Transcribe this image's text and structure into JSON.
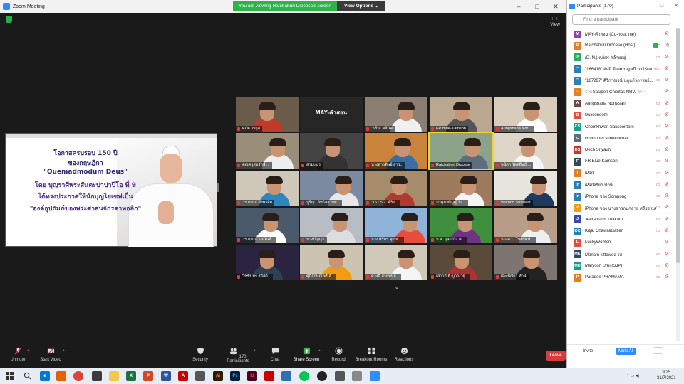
{
  "window": {
    "title": "Zoom Meeting",
    "banner": "You are viewing Ratchaburi Diocese's screen",
    "view_options": "View Options",
    "view_button": "View"
  },
  "slide": {
    "lines": [
      "โอกาสครบรอบ 150 ปี",
      "ของกฤษฎีกา",
      "\"Quemadmodum Deus\"",
      "โดย บุญราศีพระสันตะปาปาปีโอ ที่ 9",
      "ได้ทรงประกาศให้นักบุญโยเซฟเป็น",
      "\"องค์อุปถัมภ์ของพระศาสนจักรคาทอลิก\""
    ]
  },
  "tiles": [
    "ศุภัต วรกุล",
    "MAY-คำสอน",
    "\"ธรีน\" คลินิค",
    "FR.Blue-Kamson",
    "Aungshana Nor...",
    "คุณครูสุขรักษ์ ...",
    "สามเณร",
    "นางสาวทิพย์ สาร...",
    "Ratchaburi Diocese",
    "พนิดา รัตตสินธุ์ ...",
    "วราภรณ์ คึงพรจิต",
    "ปูรีญา อิทธิสงวนท...",
    "\"167297\" ศิริก...",
    "ภาศุภายัญญ์ มิ่ง...",
    "Waroon Srisawat",
    "วราภรณ์ ธนนันท์...",
    "นางปัญญา",
    "นาง ศิริพร คุณพ...",
    "น.ส. อุษาภัณ ค...",
    "นางสาว โชติรัตน์...",
    "วิชชินทร์ สวัสดิ์...",
    "ศุภิลักษณ์ พนิลั...",
    "ดวงดี สายพันธ์...",
    "เสาวณีย์ ญาณาตุ...",
    "iPadจริยา ทักษ์"
  ],
  "toolbar": {
    "unmute": "Unmute",
    "start_video": "Start Video",
    "security": "Security",
    "participants": "Participants",
    "participant_count": "170",
    "chat": "Chat",
    "share_screen": "Share Screen",
    "record": "Record",
    "breakout_rooms": "Breakout Rooms",
    "reactions": "Reactions",
    "leave": "Leave"
  },
  "panel": {
    "title": "Participants (170)",
    "search_placeholder": "Find a participant",
    "participants": [
      {
        "initial": "M",
        "name": "MAY-คำสอน (Co-host, me)",
        "color": "#8e44ad"
      },
      {
        "initial": "R",
        "name": "Ratchaburi Diocese (Host)",
        "color": "#e67e22"
      },
      {
        "initial": "(N",
        "name": "(D. N.) ศุภัศร คล้ายอยู่",
        "color": "#27ae60"
      },
      {
        "initial": "\"",
        "name": "\"166418\" อัจฉิ ต้นสมบุญหนี นาริรัฒนา...",
        "color": "#2980b9"
      },
      {
        "initial": "\"",
        "name": "\"167297\" ศิริกาญจน์ ปฏุแก้วกรรมย์...",
        "color": "#2980b9"
      },
      {
        "initial": "♡",
        "name": "♡☆Sasipen Chitutas NRV. ☆♡",
        "color": "#e67e22"
      },
      {
        "initial": "A",
        "name": "Aungshana Norrasan",
        "color": "#6d4c41"
      },
      {
        "initial": "B",
        "name": "Bosconoom",
        "color": "#e74c3c"
      },
      {
        "initial": "CS",
        "name": "Chomkhwan Saksoontorn",
        "color": "#16a085"
      },
      {
        "initial": "c",
        "name": "chumporn srinukulchai",
        "color": "#5d6d7e"
      },
      {
        "initial": "DS",
        "name": "Dech Sriyaun",
        "color": "#c0392b"
      },
      {
        "initial": "F",
        "name": "FR.Blue-Kamson",
        "color": "#34495e"
      },
      {
        "initial": "I",
        "name": "iPad",
        "color": "#e67e22"
      },
      {
        "initial": "In",
        "name": "iPadจริยา ทักษ์",
        "color": "#2980b9"
      },
      {
        "initial": "In",
        "name": "iPhone ของ Sompong",
        "color": "#2980b9"
      },
      {
        "initial": "In",
        "name": "iPhone ของ นางสาวกนกลาย ศรีธรรมจ...",
        "color": "#f39c12"
      },
      {
        "initial": "J",
        "name": "Jeeranutch Thakam",
        "color": "#3949ab"
      },
      {
        "initial": "KC",
        "name": "Kitja. Chawalitsatien",
        "color": "#2980b9"
      },
      {
        "initial": "L",
        "name": "LuckyWomen",
        "color": "#e74c3c"
      },
      {
        "initial": "MK",
        "name": "Mariam kittawee รส",
        "color": "#34495e"
      },
      {
        "initial": "MU",
        "name": "Marycon Urbi (SJP)",
        "color": "#16a085"
      },
      {
        "initial": "P",
        "name": "Paradee PRAMAMA",
        "color": "#e67e22"
      }
    ],
    "invite": "Invite",
    "mute_all": "Mute All",
    "more": "..."
  },
  "taskbar": {
    "time": "9:25",
    "date": "31/7/2021"
  }
}
